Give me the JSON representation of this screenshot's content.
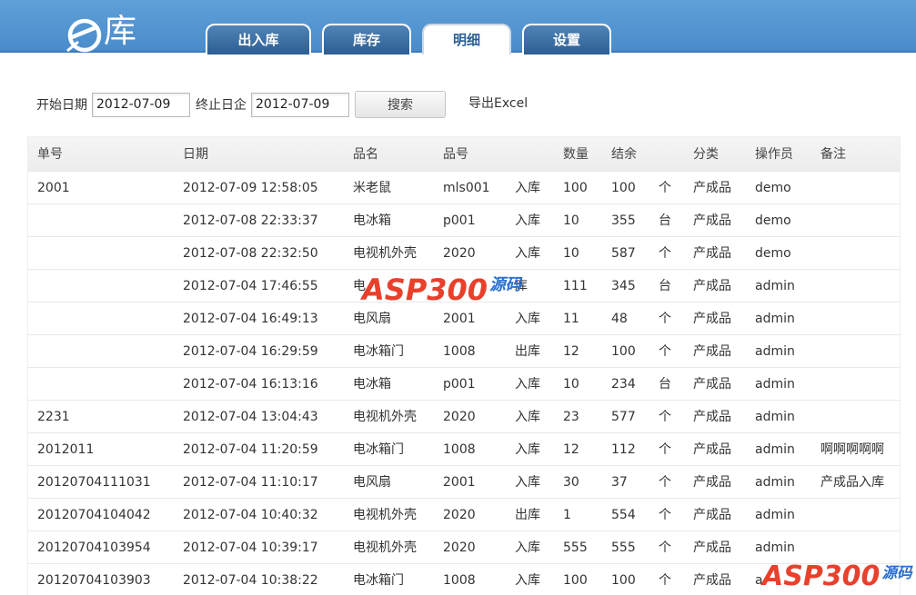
{
  "header": {
    "logo_text": "库",
    "tabs": [
      {
        "label": "出入库",
        "active": false
      },
      {
        "label": "库存",
        "active": false
      },
      {
        "label": "明细",
        "active": true
      },
      {
        "label": "设置",
        "active": false
      }
    ]
  },
  "filters": {
    "start_label": "开始日期",
    "start_value": "2012-07-09",
    "end_label": "终止日企",
    "end_value": "2012-07-09",
    "search_label": "搜索",
    "export_label": "导出Excel"
  },
  "table": {
    "headers": [
      "单号",
      "日期",
      "品名",
      "品号",
      "数量",
      "结余",
      "分类",
      "操作员",
      "备注"
    ],
    "rows": [
      {
        "id": "2001",
        "date": "2012-07-09 12:58:05",
        "name": "米老鼠",
        "code": "mls001",
        "type": "入库",
        "qty": "100",
        "balance": "100",
        "unit": "个",
        "category": "产成品",
        "operator": "demo",
        "note": ""
      },
      {
        "id": "",
        "date": "2012-07-08 22:33:37",
        "name": "电冰箱",
        "code": "p001",
        "type": "入库",
        "qty": "10",
        "balance": "355",
        "unit": "台",
        "category": "产成品",
        "operator": "demo",
        "note": ""
      },
      {
        "id": "",
        "date": "2012-07-08 22:32:50",
        "name": "电视机外壳",
        "code": "2020",
        "type": "入库",
        "qty": "10",
        "balance": "587",
        "unit": "个",
        "category": "产成品",
        "operator": "demo",
        "note": ""
      },
      {
        "id": "",
        "date": "2012-07-04 17:46:55",
        "name": "电",
        "code": "",
        "type": "库",
        "qty": "111",
        "balance": "345",
        "unit": "台",
        "category": "产成品",
        "operator": "admin",
        "note": ""
      },
      {
        "id": "",
        "date": "2012-07-04 16:49:13",
        "name": "电风扇",
        "code": "2001",
        "type": "入库",
        "qty": "11",
        "balance": "48",
        "unit": "个",
        "category": "产成品",
        "operator": "admin",
        "note": ""
      },
      {
        "id": "",
        "date": "2012-07-04 16:29:59",
        "name": "电冰箱门",
        "code": "1008",
        "type": "出库",
        "qty": "12",
        "balance": "100",
        "unit": "个",
        "category": "产成品",
        "operator": "admin",
        "note": ""
      },
      {
        "id": "",
        "date": "2012-07-04 16:13:16",
        "name": "电冰箱",
        "code": "p001",
        "type": "入库",
        "qty": "10",
        "balance": "234",
        "unit": "台",
        "category": "产成品",
        "operator": "admin",
        "note": ""
      },
      {
        "id": "2231",
        "date": "2012-07-04 13:04:43",
        "name": "电视机外壳",
        "code": "2020",
        "type": "入库",
        "qty": "23",
        "balance": "577",
        "unit": "个",
        "category": "产成品",
        "operator": "admin",
        "note": ""
      },
      {
        "id": "2012011",
        "date": "2012-07-04 11:20:59",
        "name": "电冰箱门",
        "code": "1008",
        "type": "入库",
        "qty": "12",
        "balance": "112",
        "unit": "个",
        "category": "产成品",
        "operator": "admin",
        "note": "啊啊啊啊啊"
      },
      {
        "id": "20120704111031",
        "date": "2012-07-04 11:10:17",
        "name": "电风扇",
        "code": "2001",
        "type": "入库",
        "qty": "30",
        "balance": "37",
        "unit": "个",
        "category": "产成品",
        "operator": "admin",
        "note": "产成品入库"
      },
      {
        "id": "20120704104042",
        "date": "2012-07-04 10:40:32",
        "name": "电视机外壳",
        "code": "2020",
        "type": "出库",
        "qty": "1",
        "balance": "554",
        "unit": "个",
        "category": "产成品",
        "operator": "admin",
        "note": ""
      },
      {
        "id": "20120704103954",
        "date": "2012-07-04 10:39:17",
        "name": "电视机外壳",
        "code": "2020",
        "type": "入库",
        "qty": "555",
        "balance": "555",
        "unit": "个",
        "category": "产成品",
        "operator": "admin",
        "note": ""
      },
      {
        "id": "20120704103903",
        "date": "2012-07-04 10:38:22",
        "name": "电冰箱门",
        "code": "1008",
        "type": "入库",
        "qty": "100",
        "balance": "100",
        "unit": "个",
        "category": "产成品",
        "operator": "a",
        "note": ""
      }
    ]
  },
  "watermark": {
    "text": "ASP300",
    "suffix": "源码"
  },
  "colors": {
    "header_bg": "#4a8ccb",
    "tab_bg": "#2d5e93",
    "tab_active_text": "#2b5e96",
    "watermark_red": "#e8402b",
    "watermark_blue": "#2a6fd0"
  }
}
